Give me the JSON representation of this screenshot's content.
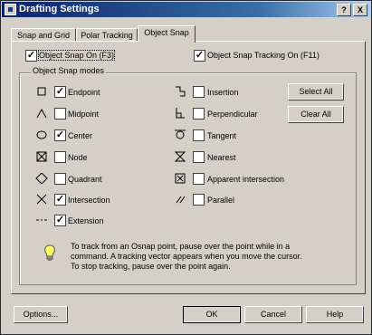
{
  "window": {
    "title": "Drafting Settings",
    "help_btn": "?",
    "close_btn": "X"
  },
  "tabs": [
    {
      "label": "Snap and Grid"
    },
    {
      "label": "Polar Tracking"
    },
    {
      "label": "Object Snap"
    }
  ],
  "object_snap_on": {
    "label": "Object Snap On (F3)",
    "checked": true
  },
  "tracking_on": {
    "label": "Object Snap Tracking On (F11)",
    "checked": true
  },
  "modes_title": "Object Snap modes",
  "left_modes": [
    {
      "label": "Endpoint",
      "icon": "square",
      "checked": true
    },
    {
      "label": "Midpoint",
      "icon": "triangle",
      "checked": false
    },
    {
      "label": "Center",
      "icon": "circle",
      "checked": true
    },
    {
      "label": "Node",
      "icon": "crossed-square",
      "checked": false
    },
    {
      "label": "Quadrant",
      "icon": "diamond",
      "checked": false
    },
    {
      "label": "Intersection",
      "icon": "x-cross",
      "checked": true
    },
    {
      "label": "Extension",
      "icon": "dash-line",
      "checked": true
    }
  ],
  "right_modes": [
    {
      "label": "Insertion",
      "icon": "insertion",
      "checked": false
    },
    {
      "label": "Perpendicular",
      "icon": "perpendicular",
      "checked": false
    },
    {
      "label": "Tangent",
      "icon": "tangent",
      "checked": false
    },
    {
      "label": "Nearest",
      "icon": "hourglass",
      "checked": false
    },
    {
      "label": "Apparent intersection",
      "icon": "apparent-intersection",
      "checked": false
    },
    {
      "label": "Parallel",
      "icon": "parallel",
      "checked": false
    }
  ],
  "select_all": "Select All",
  "clear_all": "Clear All",
  "info_lines": [
    "To track from an Osnap point, pause over the point while in a",
    "command.  A tracking vector appears when you move the cursor.",
    "To stop tracking, pause over the point again."
  ],
  "buttons": {
    "options": "Options...",
    "ok": "OK",
    "cancel": "Cancel",
    "help": "Help"
  },
  "check_glyph": "✓"
}
